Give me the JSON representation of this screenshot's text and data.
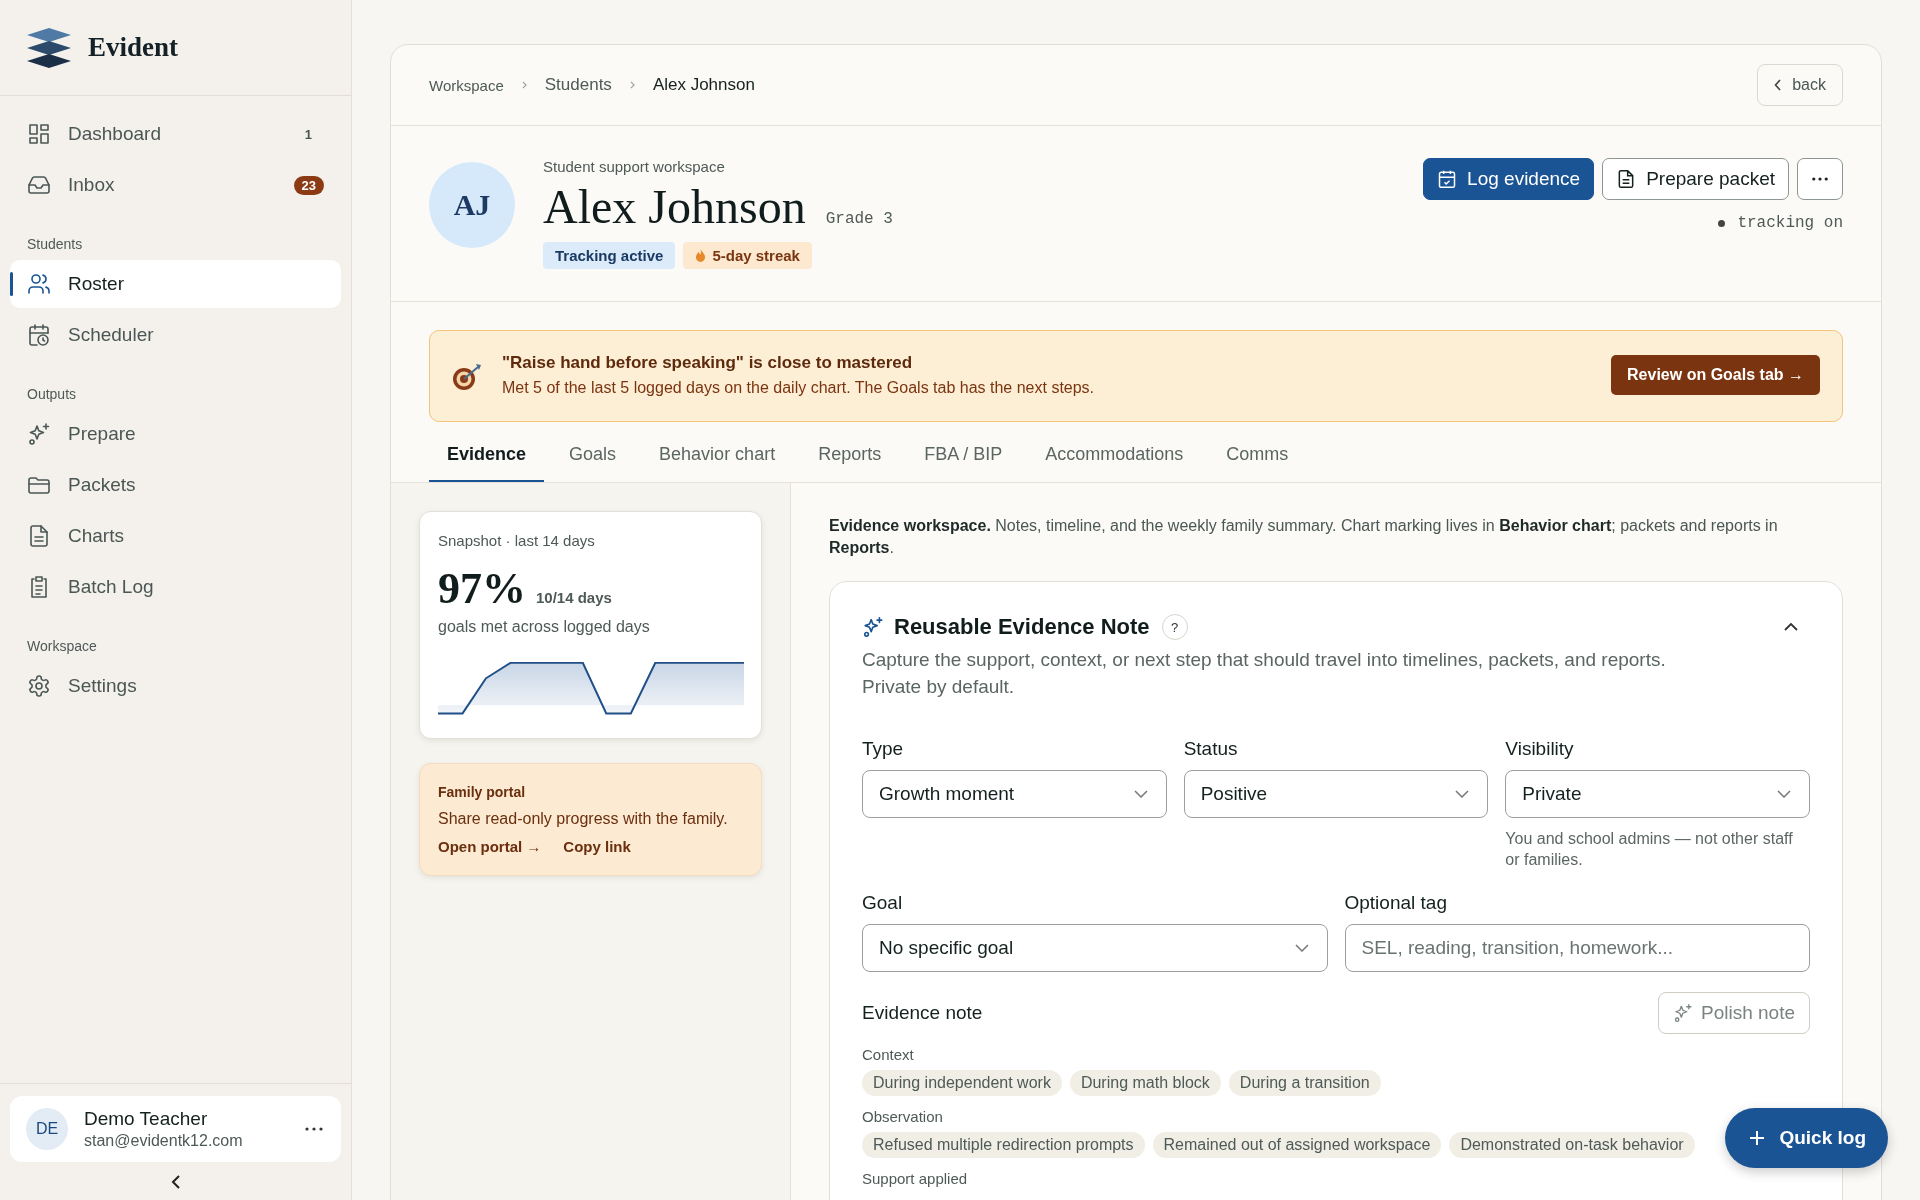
{
  "brand": {
    "name": "Evident"
  },
  "sidebar": {
    "groups": [
      {
        "items": [
          {
            "label": "Dashboard",
            "selected": false,
            "badge": {
              "text": "1",
              "kind": "plain"
            }
          },
          {
            "label": "Inbox",
            "selected": false,
            "badge": {
              "text": "23",
              "kind": "pill"
            }
          }
        ]
      },
      {
        "heading": "Students",
        "items": [
          {
            "label": "Roster",
            "selected": true
          },
          {
            "label": "Scheduler",
            "selected": false
          }
        ]
      },
      {
        "heading": "Outputs",
        "items": [
          {
            "label": "Prepare",
            "selected": false
          },
          {
            "label": "Packets",
            "selected": false
          },
          {
            "label": "Charts",
            "selected": false
          },
          {
            "label": "Batch Log",
            "selected": false
          }
        ]
      },
      {
        "heading": "Workspace",
        "items": [
          {
            "label": "Settings",
            "selected": false
          }
        ]
      }
    ],
    "user": {
      "initials": "DE",
      "name": "Demo Teacher",
      "email": "stan@evidentk12.com"
    }
  },
  "breadcrumb": [
    "Workspace",
    "Students",
    "Alex Johnson"
  ],
  "back_button": "back",
  "student": {
    "initials": "AJ",
    "eyebrow": "Student support workspace",
    "name": "Alex Johnson",
    "grade": "Grade 3",
    "tags": [
      {
        "label": "Tracking active",
        "kind": "info"
      },
      {
        "label": "5-day streak",
        "kind": "streak"
      }
    ],
    "actions": [
      {
        "label": "Log evidence",
        "kind": "primary"
      },
      {
        "label": "Prepare packet",
        "kind": "secondary"
      }
    ],
    "status": "tracking on"
  },
  "banner": {
    "title": "\"Raise hand before speaking\" is close to mastered",
    "text": "Met 5 of the last 5 logged days on the daily chart. The Goals tab has the next steps.",
    "button": "Review on Goals tab →"
  },
  "tabs": [
    {
      "label": "Evidence",
      "selected": true
    },
    {
      "label": "Goals",
      "selected": false
    },
    {
      "label": "Behavior chart",
      "selected": false
    },
    {
      "label": "Reports",
      "selected": false
    },
    {
      "label": "FBA / BIP",
      "selected": false
    },
    {
      "label": "Accommodations",
      "selected": false
    },
    {
      "label": "Comms",
      "selected": false
    }
  ],
  "snapshot": {
    "label": "Snapshot · last 14 days",
    "value": "97%",
    "sub": "10/14 days",
    "caption": "goals met across logged days"
  },
  "family_portal": {
    "title": "Family portal",
    "text": "Share read-only progress with the family.",
    "links": [
      "Open portal →",
      "Copy link"
    ]
  },
  "intro": "**Evidence workspace.** Notes, timeline, and the weekly family summary. Chart marking lives in **Behavior chart**; packets and reports in **Reports**.",
  "note": {
    "title": "Reusable Evidence Note",
    "help": "?",
    "expanded": true,
    "description": "Capture the support, context, or next step that should travel into timelines, packets, and reports. Private by default.",
    "fields_row_1": [
      {
        "label": "Type",
        "value": "Growth moment",
        "kind": "select"
      },
      {
        "label": "Status",
        "value": "Positive",
        "kind": "select"
      },
      {
        "label": "Visibility",
        "value": "Private",
        "kind": "select",
        "hint": "You and school admins — not other staff or families."
      }
    ],
    "fields_row_2": [
      {
        "label": "Goal",
        "value": "No specific goal",
        "kind": "select"
      },
      {
        "label": "Optional tag",
        "placeholder": "SEL, reading, transition, homework...",
        "kind": "text"
      }
    ],
    "note_label": "Evidence note",
    "polish_button": {
      "label": "Polish note",
      "disabled": true
    },
    "chip_groups": [
      {
        "heading": "Context",
        "chips": [
          "During independent work",
          "During math block",
          "During a transition"
        ]
      },
      {
        "heading": "Observation",
        "chips": [
          "Refused multiple redirection prompts",
          "Remained out of assigned workspace",
          "Demonstrated on-task behavior"
        ]
      },
      {
        "heading": "Support applied"
      }
    ]
  },
  "quick_log": "Quick log"
}
